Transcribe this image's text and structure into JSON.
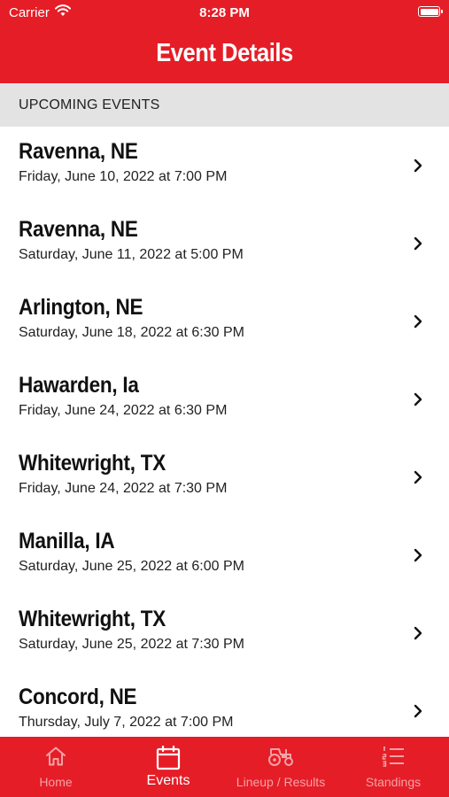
{
  "status_bar": {
    "carrier": "Carrier",
    "time": "8:28 PM"
  },
  "header": {
    "title": "Event Details"
  },
  "section": {
    "header": "UPCOMING EVENTS"
  },
  "events": [
    {
      "name": "Ravenna, NE",
      "date": "Friday, June 10, 2022 at 7:00 PM"
    },
    {
      "name": "Ravenna, NE",
      "date": "Saturday, June 11, 2022 at 5:00 PM"
    },
    {
      "name": "Arlington, NE",
      "date": "Saturday, June 18, 2022 at 6:30 PM"
    },
    {
      "name": "Hawarden, Ia",
      "date": "Friday, June 24, 2022 at 6:30 PM"
    },
    {
      "name": "Whitewright, TX",
      "date": "Friday, June 24, 2022 at 7:30 PM"
    },
    {
      "name": "Manilla, IA",
      "date": "Saturday, June 25, 2022 at 6:00 PM"
    },
    {
      "name": "Whitewright, TX",
      "date": "Saturday, June 25, 2022 at 7:30 PM"
    },
    {
      "name": "Concord, NE",
      "date": "Thursday, July 7, 2022 at 7:00 PM"
    }
  ],
  "tabs": [
    {
      "label": "Home",
      "icon": "home-icon",
      "active": false
    },
    {
      "label": "Events",
      "icon": "calendar-icon",
      "active": true
    },
    {
      "label": "Lineup / Results",
      "icon": "tractor-icon",
      "active": false
    },
    {
      "label": "Standings",
      "icon": "list-icon",
      "active": false
    }
  ],
  "colors": {
    "brand": "#e51d27",
    "section_bg": "#e3e3e3",
    "tab_inactive": "#f2a3a6"
  }
}
